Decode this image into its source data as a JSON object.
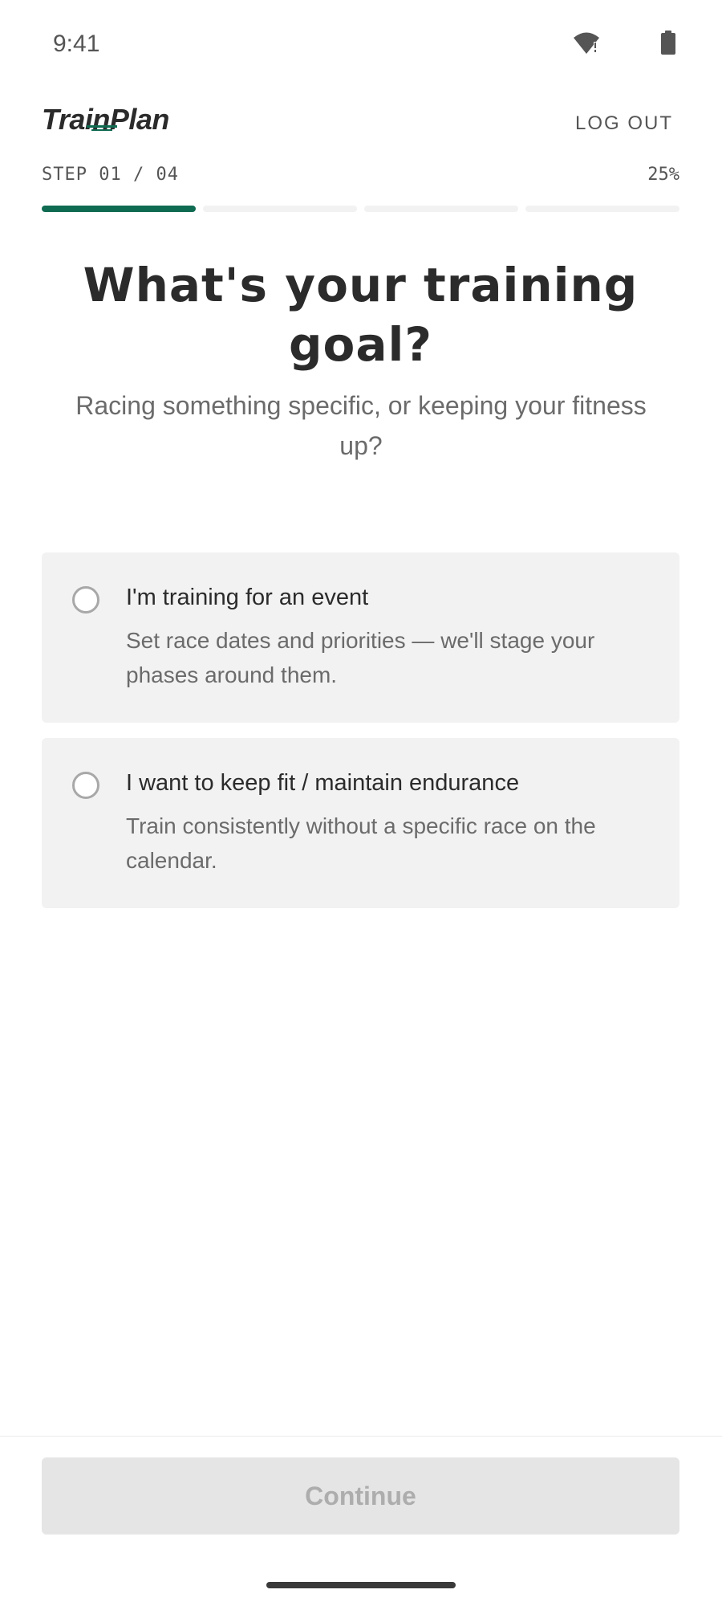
{
  "status_bar": {
    "time": "9:41",
    "icons": [
      "wifi-alert-icon",
      "battery-icon"
    ]
  },
  "header": {
    "logo": "TrainPlan",
    "logout_label": "LOG OUT"
  },
  "progress": {
    "step_label": "STEP 01 / 04",
    "percent_label": "25%",
    "current_step": 1,
    "total_steps": 4,
    "accent_color": "#0f6b52",
    "track_color": "#f2f2f2"
  },
  "main": {
    "title": "What's your training goal?",
    "subtitle": "Racing something specific, or keeping your fitness up?"
  },
  "options": [
    {
      "title": "I'm training for an event",
      "description": "Set race dates and priorities — we'll stage your phases around them.",
      "selected": false
    },
    {
      "title": "I want to keep fit / maintain endurance",
      "description": "Train consistently without a specific race on the calendar.",
      "selected": false
    }
  ],
  "footer": {
    "continue_label": "Continue",
    "continue_enabled": false
  }
}
